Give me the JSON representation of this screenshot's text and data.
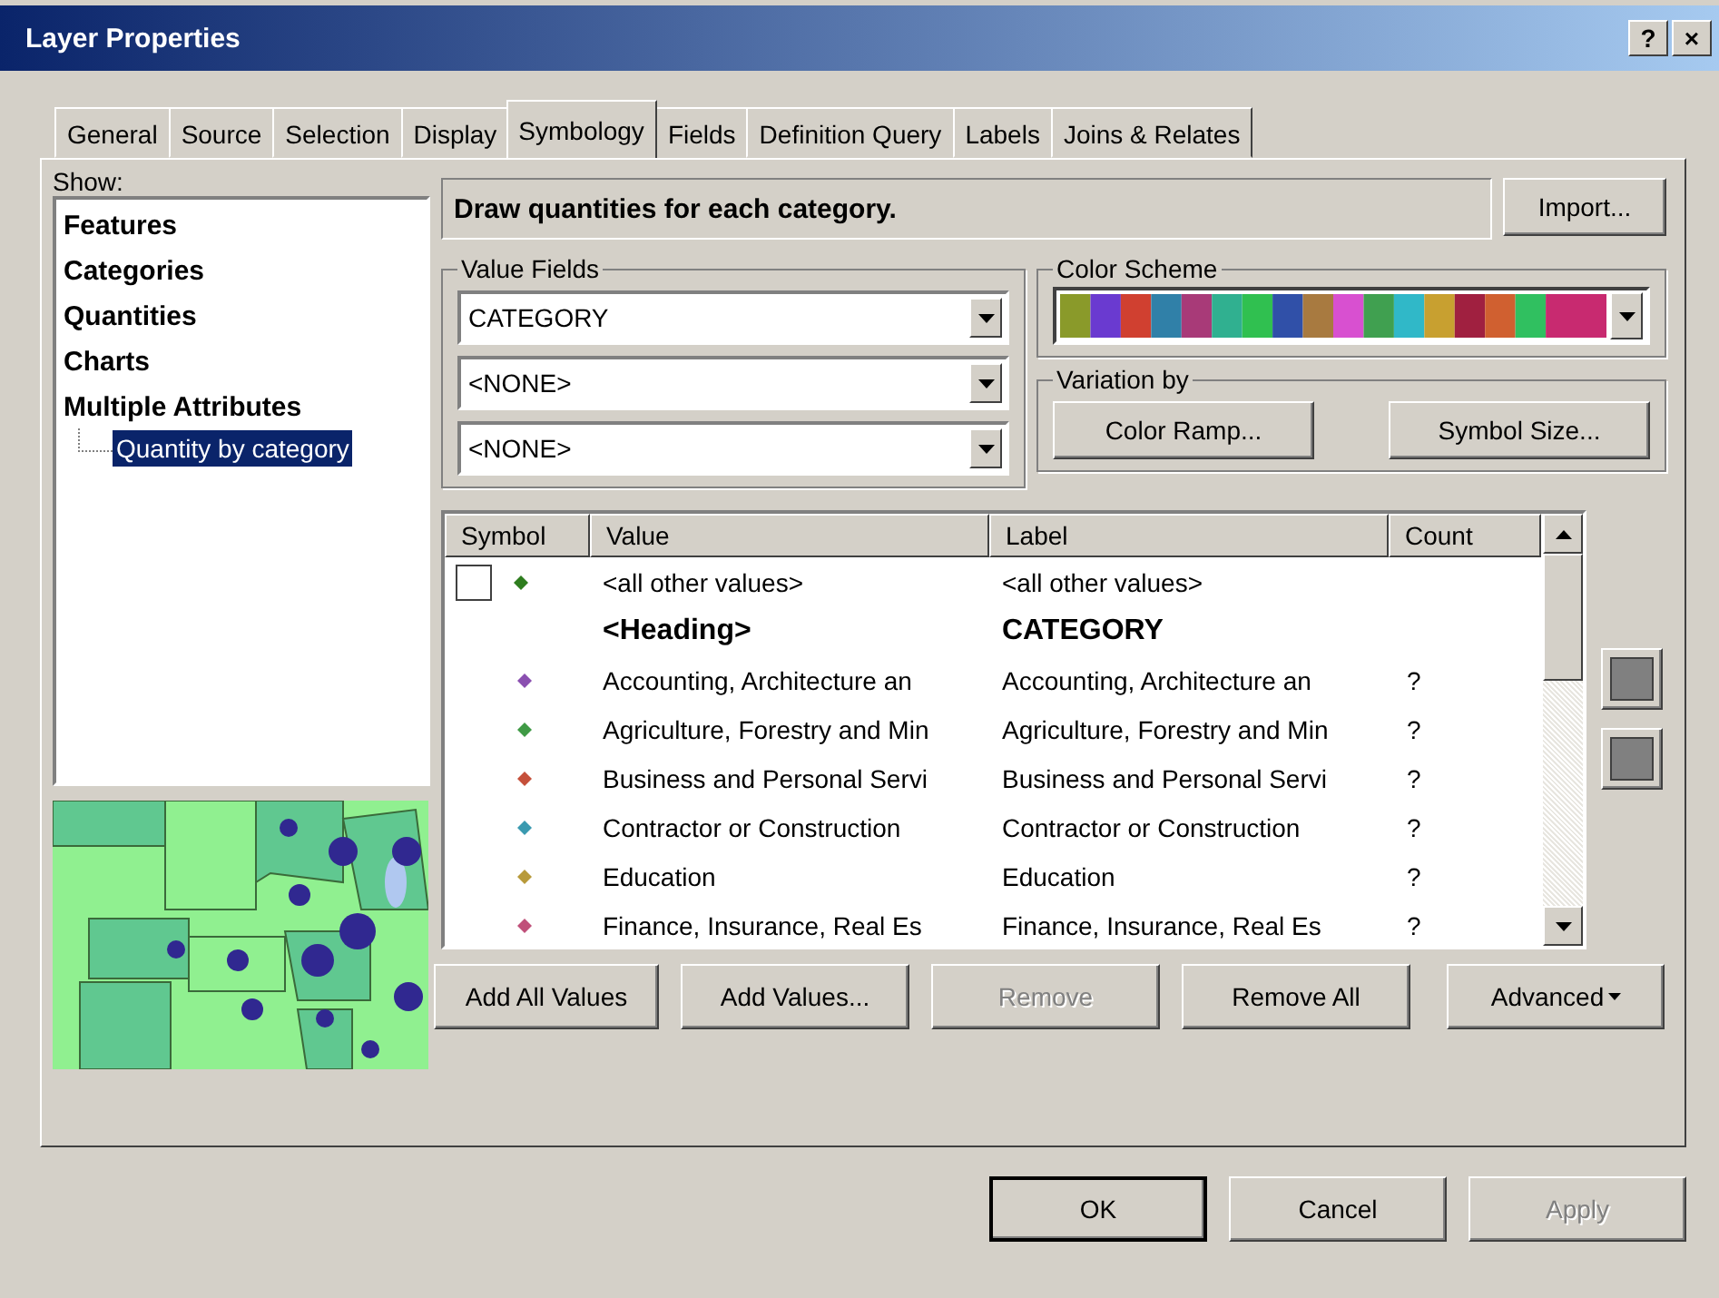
{
  "window": {
    "title": "Layer Properties",
    "buttons": [
      "?",
      "×"
    ]
  },
  "tabs": [
    {
      "label": "General",
      "selected": false
    },
    {
      "label": "Source",
      "selected": false
    },
    {
      "label": "Selection",
      "selected": false
    },
    {
      "label": "Display",
      "selected": false
    },
    {
      "label": "Symbology",
      "selected": true
    },
    {
      "label": "Fields",
      "selected": false
    },
    {
      "label": "Definition Query",
      "selected": false
    },
    {
      "label": "Labels",
      "selected": false
    },
    {
      "label": "Joins & Relates",
      "selected": false
    }
  ],
  "show": {
    "label": "Show:",
    "items": [
      {
        "label": "Features",
        "selected": false
      },
      {
        "label": "Categories",
        "selected": false
      },
      {
        "label": "Quantities",
        "selected": false
      },
      {
        "label": "Charts",
        "selected": false
      },
      {
        "label": "Multiple Attributes",
        "selected": false,
        "children": [
          {
            "label": "Quantity by category",
            "selected": true
          }
        ]
      }
    ]
  },
  "description": "Draw quantities for each category.",
  "import_button": "Import...",
  "value_fields": {
    "title": "Value Fields",
    "fields": [
      "CATEGORY",
      "<NONE>",
      "<NONE>"
    ]
  },
  "color_scheme": {
    "title": "Color Scheme"
  },
  "variation": {
    "title": "Variation by",
    "buttons": [
      "Color Ramp...",
      "Symbol Size..."
    ]
  },
  "table": {
    "columns": [
      "Symbol",
      "Value",
      "Label",
      "Count"
    ],
    "rows": [
      {
        "kind": "other",
        "checked": false,
        "color": "#2e7d1e",
        "value": "<all other values>",
        "label": "<all other values>",
        "count": ""
      },
      {
        "kind": "heading",
        "value": "<Heading>",
        "label": "CATEGORY",
        "count": ""
      },
      {
        "kind": "value",
        "color": "#8a4fb0",
        "value": "Accounting, Architecture an",
        "label": "Accounting, Architecture an",
        "count": "?"
      },
      {
        "kind": "value",
        "color": "#3f9a45",
        "value": "Agriculture, Forestry and Min",
        "label": "Agriculture, Forestry and Min",
        "count": "?"
      },
      {
        "kind": "value",
        "color": "#c5503a",
        "value": "Business and Personal Servi",
        "label": "Business and Personal Servi",
        "count": "?"
      },
      {
        "kind": "value",
        "color": "#3a9ab0",
        "value": "Contractor or Construction",
        "label": "Contractor or Construction",
        "count": "?"
      },
      {
        "kind": "value",
        "color": "#b89a3a",
        "value": "Education",
        "label": "Education",
        "count": "?"
      },
      {
        "kind": "value",
        "color": "#c0507a",
        "value": "Finance, Insurance, Real Es",
        "label": "Finance, Insurance, Real Es",
        "count": "?"
      }
    ]
  },
  "table_buttons": [
    {
      "label": "Add All Values",
      "disabled": false
    },
    {
      "label": "Add Values...",
      "disabled": false
    },
    {
      "label": "Remove",
      "disabled": true
    },
    {
      "label": "Remove All",
      "disabled": false
    }
  ],
  "advanced_button": "Advanced",
  "dialog_buttons": [
    {
      "label": "OK",
      "disabled": false,
      "default": true
    },
    {
      "label": "Cancel",
      "disabled": false,
      "default": false
    },
    {
      "label": "Apply",
      "disabled": true,
      "default": false
    }
  ]
}
